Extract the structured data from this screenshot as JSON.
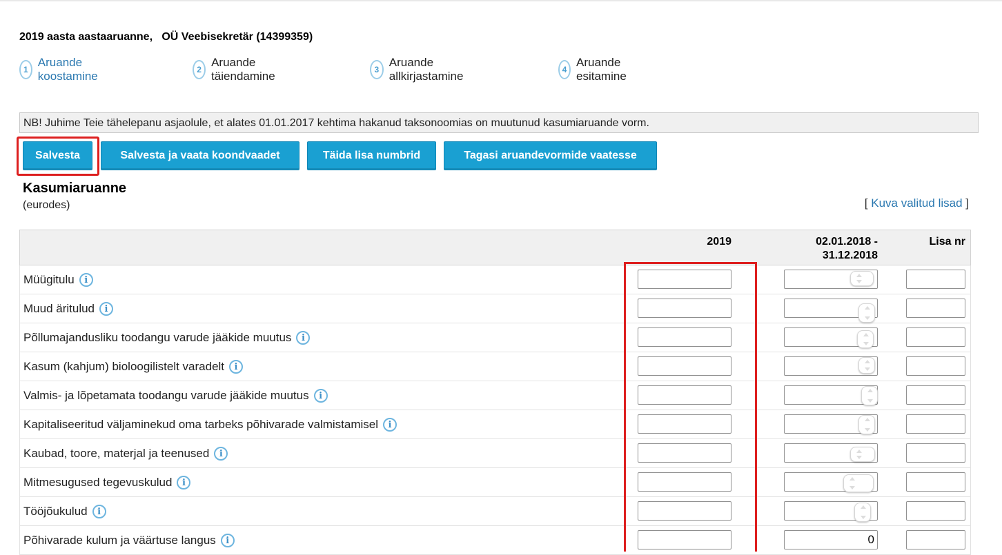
{
  "report": {
    "title": "2019 aasta aastaaruanne,   OÜ Veebisekretär (14399359)"
  },
  "steps": [
    {
      "number": "1",
      "label": "Aruande koostamine",
      "active": true
    },
    {
      "number": "2",
      "label": "Aruande täiendamine",
      "active": false
    },
    {
      "number": "3",
      "label": "Aruande allkirjastamine",
      "active": false
    },
    {
      "number": "4",
      "label": "Aruande esitamine",
      "active": false
    }
  ],
  "notice": "NB! Juhime Teie tähelepanu asjaolule, et alates 01.01.2017 kehtima hakanud taksonoomias on muutunud kasumiaruande vorm.",
  "buttons": {
    "save": "Salvesta",
    "save_view": "Salvesta ja vaata koondvaadet",
    "fill_numbers": "Täida lisa numbrid",
    "back": "Tagasi aruandevormide vaatesse"
  },
  "section": {
    "title": "Kasumiaruanne",
    "unit": "(eurodes)",
    "link_open": "[ ",
    "link_text": "Kuva valitud lisad",
    "link_close": " ]"
  },
  "columns": {
    "y2019": "2019",
    "y2018_line1": "02.01.2018 -",
    "y2018_line2": "31.12.2018",
    "lisa": "Lisa nr"
  },
  "rows": [
    {
      "label": "Müügitulu",
      "v2019": "",
      "v2018": "",
      "lisa": ""
    },
    {
      "label": "Muud äritulud",
      "v2019": "",
      "v2018": "",
      "lisa": ""
    },
    {
      "label": "Põllumajandusliku toodangu varude jääkide muutus",
      "v2019": "",
      "v2018": "",
      "lisa": ""
    },
    {
      "label": "Kasum (kahjum) bioloogilistelt varadelt",
      "v2019": "",
      "v2018": "",
      "lisa": ""
    },
    {
      "label": "Valmis- ja lõpetamata toodangu varude jääkide muutus",
      "v2019": "",
      "v2018": "",
      "lisa": ""
    },
    {
      "label": "Kapitaliseeritud väljaminekud oma tarbeks põhivarade valmistamisel",
      "v2019": "",
      "v2018": "",
      "lisa": ""
    },
    {
      "label": "Kaubad, toore, materjal ja teenused",
      "v2019": "",
      "v2018": "",
      "lisa": ""
    },
    {
      "label": "Mitmesugused tegevuskulud",
      "v2019": "",
      "v2018": "",
      "lisa": ""
    },
    {
      "label": "Tööjõukulud",
      "v2019": "",
      "v2018": "",
      "lisa": ""
    },
    {
      "label": "Põhivarade kulum ja väärtuse langus",
      "v2019": "",
      "v2018": "0",
      "lisa": ""
    }
  ]
}
